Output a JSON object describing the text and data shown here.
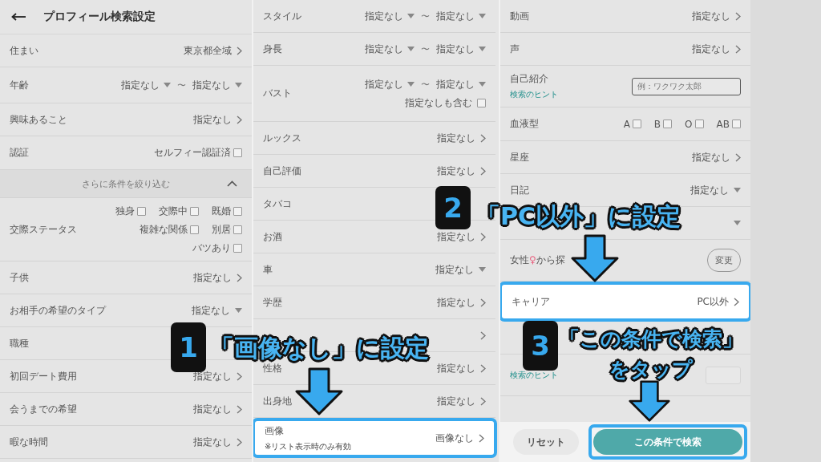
{
  "panels": [
    {
      "header": {
        "title": "プロフィール検索設定"
      },
      "rows": [
        {
          "kind": "link",
          "label": "住まい",
          "value": "東京都全域",
          "highlighted": false
        },
        {
          "kind": "range",
          "label": "年齢",
          "from": "指定なし",
          "separator": "〜",
          "to": "指定なし"
        },
        {
          "kind": "link",
          "label": "興味あること",
          "value": "指定なし",
          "highlighted": false
        },
        {
          "kind": "checks",
          "label": "認証",
          "option_lines": [
            [
              {
                "label": "セルフィー認証済",
                "checked": false
              }
            ]
          ]
        },
        {
          "kind": "section",
          "label": "さらに条件を絞り込む",
          "expanded": true
        },
        {
          "kind": "checks",
          "label": "交際ステータス",
          "option_lines": [
            [
              {
                "label": "独身",
                "checked": false
              },
              {
                "label": "交際中",
                "checked": false
              },
              {
                "label": "既婚",
                "checked": false
              }
            ],
            [
              {
                "label": "複雑な関係",
                "checked": false
              },
              {
                "label": "別居",
                "checked": false
              }
            ],
            [
              {
                "label": "バツあり",
                "checked": false
              }
            ]
          ]
        },
        {
          "kind": "link",
          "label": "子供",
          "value": "指定なし",
          "highlighted": false
        },
        {
          "kind": "dropdown",
          "label": "お相手の希望のタイプ",
          "value": "指定なし"
        },
        {
          "kind": "link",
          "label": "職種",
          "highlighted": false
        },
        {
          "kind": "link",
          "label": "初回デート費用",
          "value": "指定なし",
          "highlighted": false
        },
        {
          "kind": "link",
          "label": "会うまでの希望",
          "value": "指定なし",
          "highlighted": false
        },
        {
          "kind": "link",
          "label": "暇な時間",
          "value": "指定なし",
          "highlighted": false
        }
      ]
    },
    {
      "rows": [
        {
          "kind": "range",
          "label": "スタイル",
          "from": "指定なし",
          "separator": "〜",
          "to": "指定なし"
        },
        {
          "kind": "range",
          "label": "身長",
          "from": "指定なし",
          "separator": "〜",
          "to": "指定なし"
        },
        {
          "kind": "range",
          "label": "バスト",
          "from": "指定なし",
          "separator": "〜",
          "to": "指定なし",
          "include": {
            "label": "指定なしも含む",
            "checked": false
          }
        },
        {
          "kind": "link",
          "label": "ルックス",
          "value": "指定なし",
          "highlighted": false
        },
        {
          "kind": "link",
          "label": "自己評価",
          "value": "指定なし",
          "highlighted": false
        },
        {
          "kind": "link",
          "label": "タバコ",
          "highlighted": false
        },
        {
          "kind": "link",
          "label": "お酒",
          "value": "指定なし",
          "highlighted": false
        },
        {
          "kind": "dropdown",
          "label": "車",
          "value": "指定なし"
        },
        {
          "kind": "link",
          "label": "学歴",
          "value": "指定なし",
          "highlighted": false
        },
        {
          "kind": "link",
          "chevron": true,
          "highlighted": false
        },
        {
          "kind": "link",
          "label": "性格",
          "value": "指定なし",
          "highlighted": false
        },
        {
          "kind": "link",
          "label": "出身地",
          "value": "指定なし",
          "highlighted": false
        },
        {
          "kind": "link",
          "label": "画像",
          "note": "※リスト表示時のみ有効",
          "value": "画像なし",
          "highlighted": true
        }
      ]
    },
    {
      "rows": [
        {
          "kind": "link",
          "label": "動画",
          "value": "指定なし",
          "highlighted": false
        },
        {
          "kind": "link",
          "label": "声",
          "value": "指定なし",
          "highlighted": false
        },
        {
          "kind": "field",
          "label": "自己紹介",
          "hint": "検索のヒント",
          "placeholder": "例：ワクワク太郎"
        },
        {
          "kind": "checks",
          "label": "血液型",
          "option_lines": [
            [
              {
                "label": "A",
                "checked": false
              },
              {
                "label": "B",
                "checked": false
              },
              {
                "label": "O",
                "checked": false
              },
              {
                "label": "AB",
                "checked": false
              }
            ]
          ]
        },
        {
          "kind": "link",
          "label": "星座",
          "value": "指定なし",
          "highlighted": false
        },
        {
          "kind": "dropdown",
          "label": "日記",
          "value": "指定なし"
        },
        {
          "kind": "dropdown"
        },
        {
          "kind": "button",
          "label": "女性",
          "symbol": "♀",
          "label_tail": "から探",
          "button": "変更"
        },
        {
          "kind": "link",
          "label": "キャリア",
          "value": "PC以外",
          "highlighted": true
        },
        {
          "kind": "link",
          "chevron": false,
          "highlighted": false
        },
        {
          "kind": "field",
          "hint": "検索のヒント"
        }
      ],
      "footer": [
        {
          "kind": "reset",
          "label": "リセット",
          "highlighted": false
        },
        {
          "kind": "primary",
          "label": "この条件で検索",
          "highlighted": true
        }
      ]
    }
  ],
  "annotations": [
    {
      "number": "1",
      "lines": [
        "「画像なし」に設定"
      ]
    },
    {
      "number": "2",
      "lines": [
        "「PC以外」に設定"
      ]
    },
    {
      "number": "3",
      "lines": [
        "「この条件で検索」",
        "をタップ"
      ]
    }
  ]
}
